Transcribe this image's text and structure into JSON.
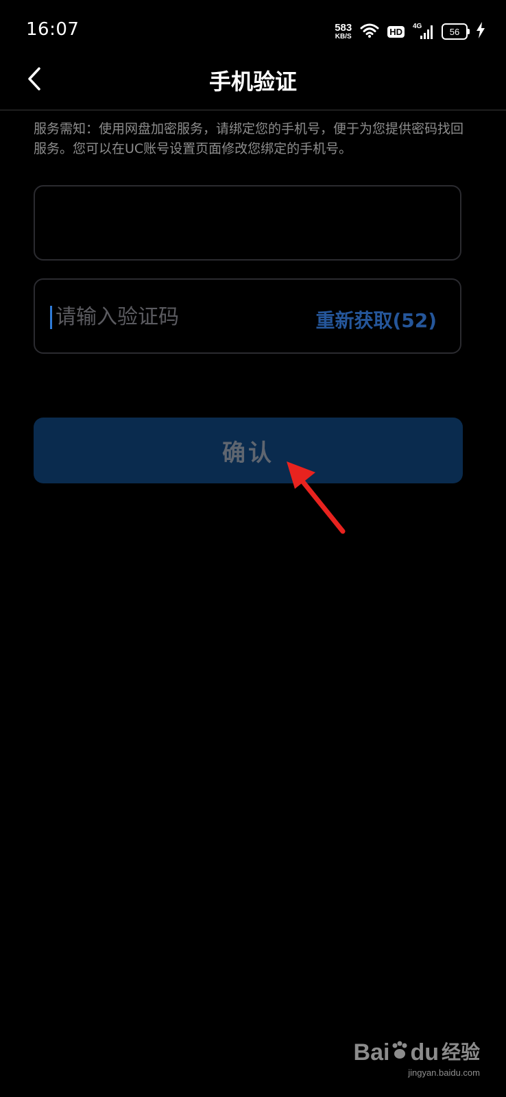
{
  "status_bar": {
    "time": "16:07",
    "net_speed_value": "583",
    "net_speed_unit": "KB/S",
    "hd_label": "HD",
    "signal_label": "4G",
    "battery_level": "56"
  },
  "header": {
    "title": "手机验证"
  },
  "notice": {
    "text": "服务需知：使用网盘加密服务，请绑定您的手机号，便于为您提供密码找回服务。您可以在UC账号设置页面修改您绑定的手机号。"
  },
  "phone_field": {
    "value": "",
    "placeholder": ""
  },
  "code_field": {
    "value": "",
    "placeholder": "请输入验证码",
    "resend_label": "重新获取(52)"
  },
  "confirm": {
    "label": "确认"
  },
  "watermark": {
    "brand_latin": "Bai",
    "brand_latin_2": "du",
    "brand_cn": "经验",
    "url": "jingyan.baidu.com"
  },
  "colors": {
    "background": "#000000",
    "accent_blue": "#2f7bd8",
    "resend_blue": "#25569a",
    "button_bg": "#0a2b4e",
    "annotation_red": "#e8231f"
  }
}
